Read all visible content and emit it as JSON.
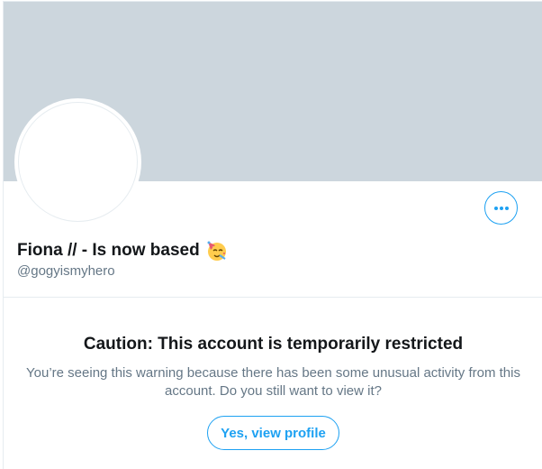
{
  "profile": {
    "display_name": "Fiona // - Is now based",
    "name_emoji_icon": "partying-face-icon",
    "handle": "@gogyismyhero"
  },
  "more_button": {
    "icon": "more-horizontal-icon"
  },
  "warning": {
    "title": "Caution: This account is temporarily restricted",
    "message": "You’re seeing this warning because there has been some unusual activity from this account. Do you still want to view it?",
    "view_button_label": "Yes, view profile"
  },
  "colors": {
    "accent": "#1da1f2",
    "banner": "#ccd6dd",
    "text_primary": "#14171a",
    "text_secondary": "#657786",
    "border": "#e6ecf0"
  }
}
